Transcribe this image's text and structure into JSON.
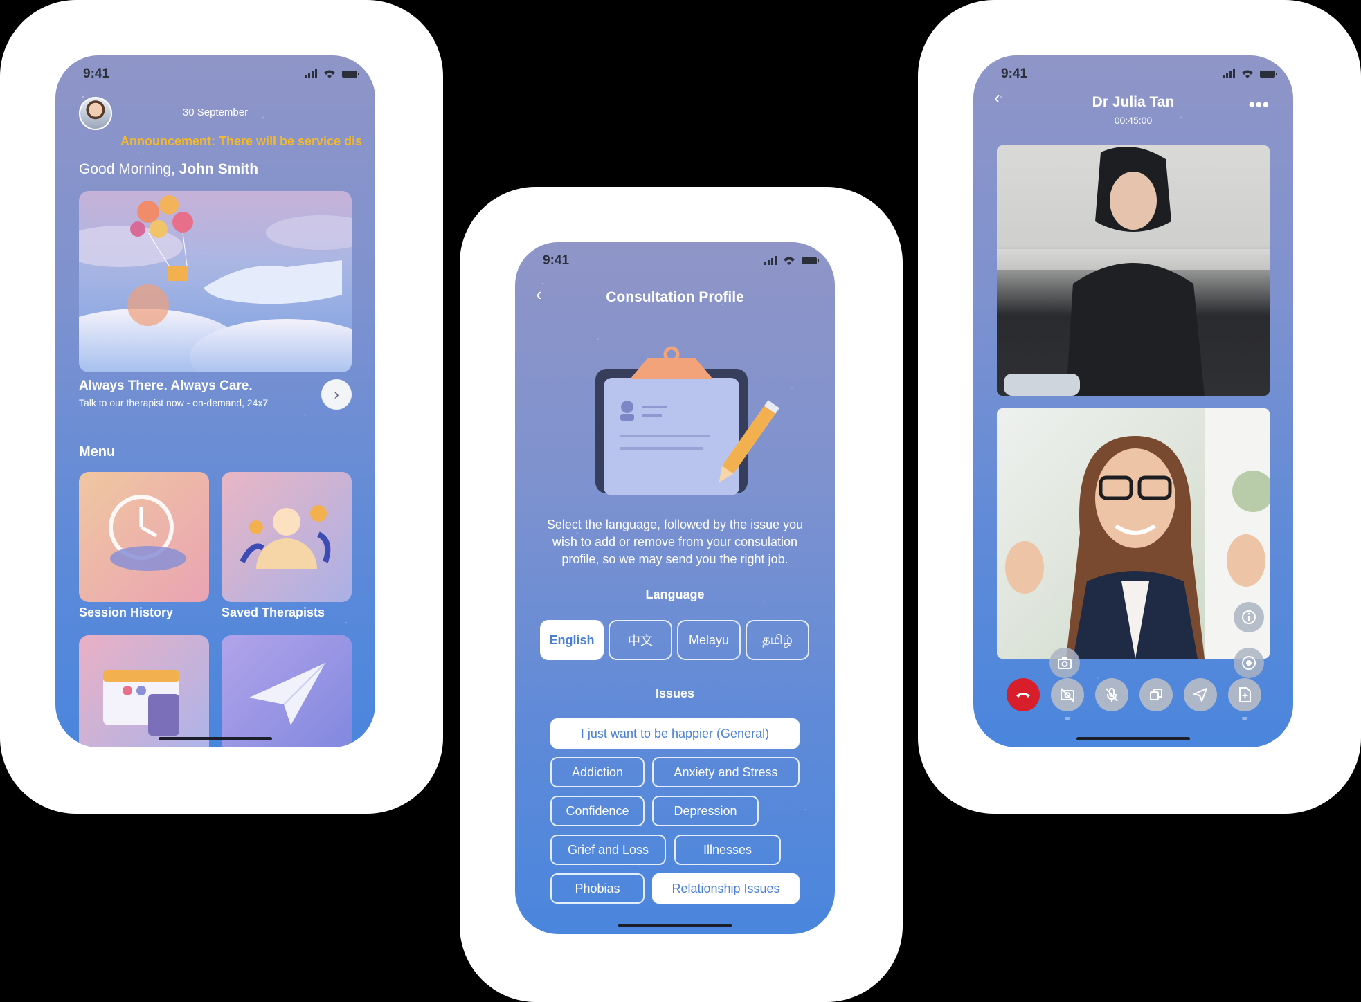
{
  "status_bar": {
    "time": "9:41"
  },
  "home": {
    "date": "30 September",
    "announcement": "Announcement: There will be service dis",
    "greeting_prefix": "Good Morning, ",
    "user_name": "John Smith",
    "hero_title": "Always There. Always Care.",
    "hero_subtitle": "Talk to our therapist now - on-demand, 24x7",
    "menu_title": "Menu",
    "menu_items": [
      {
        "label": "Session History"
      },
      {
        "label": "Saved Therapists"
      }
    ]
  },
  "consultation": {
    "title": "Consultation Profile",
    "description": "Select the language, followed by the issue you wish to add or remove from your consulation profile, so we may send you the right job.",
    "language_title": "Language",
    "languages": [
      "English",
      "中文",
      "Melayu",
      "தமிழ்"
    ],
    "selected_language": "English",
    "issues_title": "Issues",
    "issues": [
      "I just want to be happier (General)",
      "Addiction",
      "Anxiety and Stress",
      "Confidence",
      "Depression",
      "Grief and Loss",
      "Illnesses",
      "Phobias",
      "Relationship Issues"
    ],
    "selected_issues": [
      "I just want to be happier (General)",
      "Relationship Issues"
    ]
  },
  "call": {
    "doctor_name": "Dr Julia Tan",
    "duration": "00:45:00",
    "controls": [
      "end-call-icon",
      "camera-off-icon",
      "mic-off-icon",
      "switch-screen-icon",
      "send-icon",
      "file-icon"
    ]
  },
  "colors": {
    "accent": "#4a7fd4",
    "announcement": "#f3b92a",
    "end_call": "#d81e2a"
  }
}
